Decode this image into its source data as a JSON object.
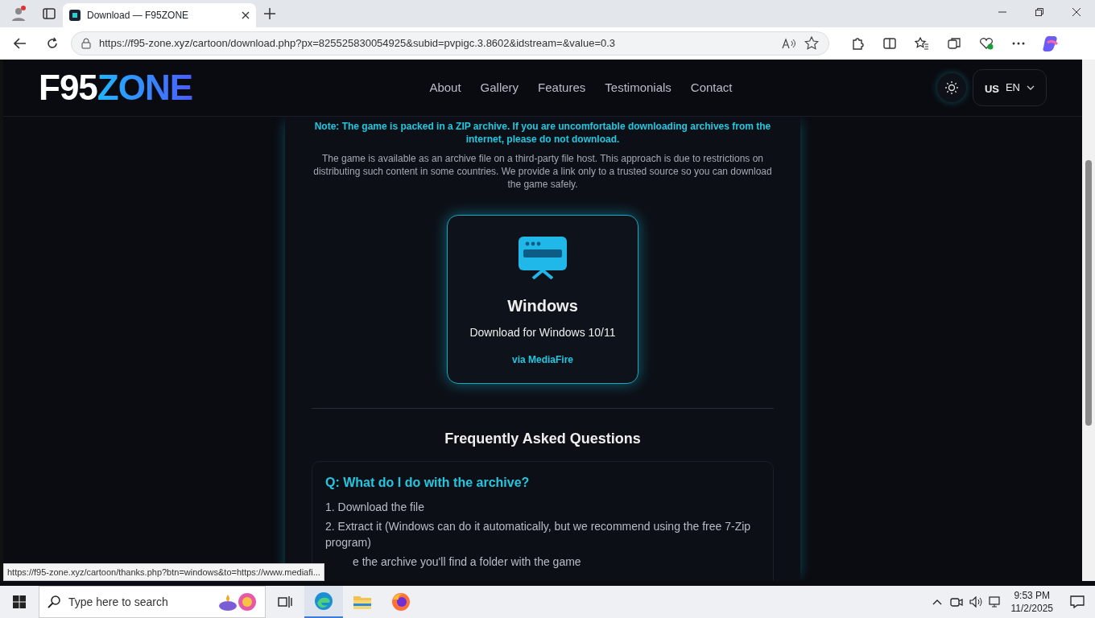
{
  "browser": {
    "tab_title": "Download — F95ZONE",
    "url": "https://f95-zone.xyz/cartoon/download.php?px=825525830054925&subid=pvpigc.3.8602&idstream=&value=0.3",
    "status_url": "https://f95-zone.xyz/cartoon/thanks.php?btn=windows&to=https://www.mediafi..."
  },
  "navbar": {
    "logo": {
      "part_1": "F95",
      "part_2": "ZONE"
    },
    "links": [
      {
        "label": "About"
      },
      {
        "label": "Gallery"
      },
      {
        "label": "Features"
      },
      {
        "label": "Testimonials"
      },
      {
        "label": "Contact"
      }
    ],
    "language": {
      "flag": "US",
      "code": "EN"
    }
  },
  "note": "Note: The game is packed in a ZIP archive. If you are uncomfortable downloading archives from the internet, please do not download.",
  "description": "The game is available as an archive file on a third-party file host. This approach is due to restrictions on distributing such content in some countries. We provide a link only to a trusted source so you can download the game safely.",
  "download_card": {
    "title": "Windows",
    "subtitle": "Download for Windows 10/11",
    "source": "via MediaFire"
  },
  "faq": {
    "heading": "Frequently Asked Questions",
    "items": [
      {
        "question": "Q: What do I do with the archive?",
        "answers": [
          "1. Download the file",
          "2. Extract it (Windows can do it automatically, but we recommend using the free 7-Zip program)",
          "e the archive you'll find a folder with the game"
        ]
      }
    ]
  },
  "taskbar": {
    "search_placeholder": "Type here to search",
    "time": "9:53 PM",
    "date": "11/2/2025"
  }
}
